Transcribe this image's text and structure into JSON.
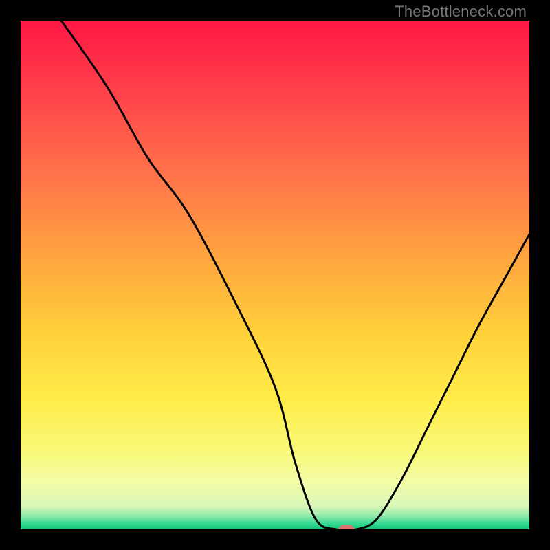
{
  "watermark": "TheBottleneck.com",
  "chart_data": {
    "type": "line",
    "title": "",
    "xlabel": "",
    "ylabel": "",
    "xlim": [
      0,
      100
    ],
    "ylim": [
      0,
      100
    ],
    "grid": false,
    "legend": false,
    "series": [
      {
        "name": "bottleneck-curve",
        "x": [
          8,
          17,
          25,
          33,
          42,
          50,
          54,
          58,
          62,
          66,
          70,
          75,
          80,
          85,
          90,
          95,
          100
        ],
        "y": [
          100,
          87,
          73,
          62,
          45,
          28,
          13,
          2,
          0,
          0,
          2,
          10,
          20,
          30,
          40,
          49,
          58
        ],
        "color": "#000000"
      }
    ],
    "marker": {
      "x": 64,
      "y": 0,
      "color": "#d9736b"
    },
    "background_gradient": {
      "stops": [
        {
          "offset": 0.0,
          "color": "#ff1744"
        },
        {
          "offset": 0.12,
          "color": "#ff3b4a"
        },
        {
          "offset": 0.3,
          "color": "#ff724a"
        },
        {
          "offset": 0.48,
          "color": "#ffa93e"
        },
        {
          "offset": 0.62,
          "color": "#ffd23a"
        },
        {
          "offset": 0.75,
          "color": "#ffed4a"
        },
        {
          "offset": 0.85,
          "color": "#f8f97a"
        },
        {
          "offset": 0.91,
          "color": "#f4fca8"
        },
        {
          "offset": 0.955,
          "color": "#d7f7b9"
        },
        {
          "offset": 0.975,
          "color": "#8ae8a8"
        },
        {
          "offset": 0.99,
          "color": "#2fd98e"
        },
        {
          "offset": 1.0,
          "color": "#17c07a"
        }
      ]
    }
  }
}
